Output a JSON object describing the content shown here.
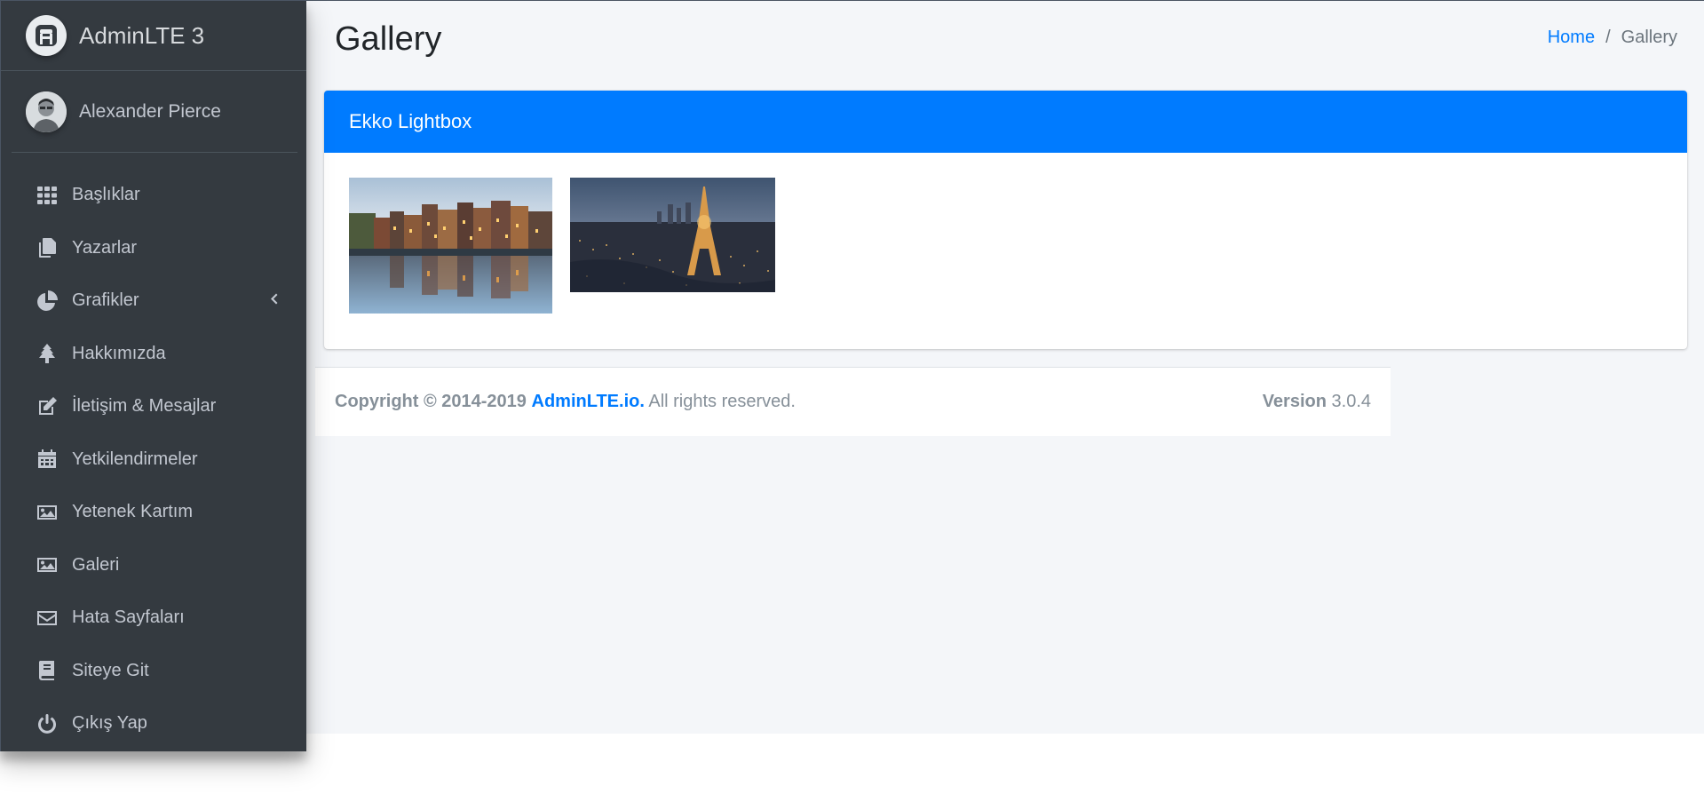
{
  "brand": {
    "name": "AdminLTE 3"
  },
  "user": {
    "name": "Alexander Pierce"
  },
  "sidebar": {
    "items": [
      {
        "label": "Başlıklar",
        "icon": "grid-icon"
      },
      {
        "label": "Yazarlar",
        "icon": "copy-icon"
      },
      {
        "label": "Grafikler",
        "icon": "chart-pie-icon",
        "has_submenu": true
      },
      {
        "label": "Hakkımızda",
        "icon": "tree-icon"
      },
      {
        "label": "İletişim & Mesajlar",
        "icon": "edit-icon"
      },
      {
        "label": "Yetkilendirmeler",
        "icon": "calendar-icon"
      },
      {
        "label": "Yetenek Kartım",
        "icon": "image-icon"
      },
      {
        "label": "Galeri",
        "icon": "image-icon"
      },
      {
        "label": "Hata Sayfaları",
        "icon": "envelope-icon"
      },
      {
        "label": "Siteye Git",
        "icon": "book-icon"
      },
      {
        "label": "Çıkış Yap",
        "icon": "power-icon"
      }
    ]
  },
  "header": {
    "title": "Gallery",
    "breadcrumb": {
      "home": "Home",
      "separator": "/",
      "current": "Gallery"
    }
  },
  "card": {
    "title": "Ekko Lightbox"
  },
  "gallery": {
    "images": [
      {
        "name": "amsterdam-canal-thumbnail"
      },
      {
        "name": "paris-eiffel-thumbnail"
      }
    ]
  },
  "footer": {
    "copyright": "Copyright © 2014-2019",
    "link": "AdminLTE.io.",
    "rights": "All rights reserved.",
    "version_label": "Version",
    "version": "3.0.4"
  },
  "colors": {
    "sidebar_bg": "#343a40",
    "primary": "#007bff",
    "content_bg": "#f4f6f9"
  }
}
